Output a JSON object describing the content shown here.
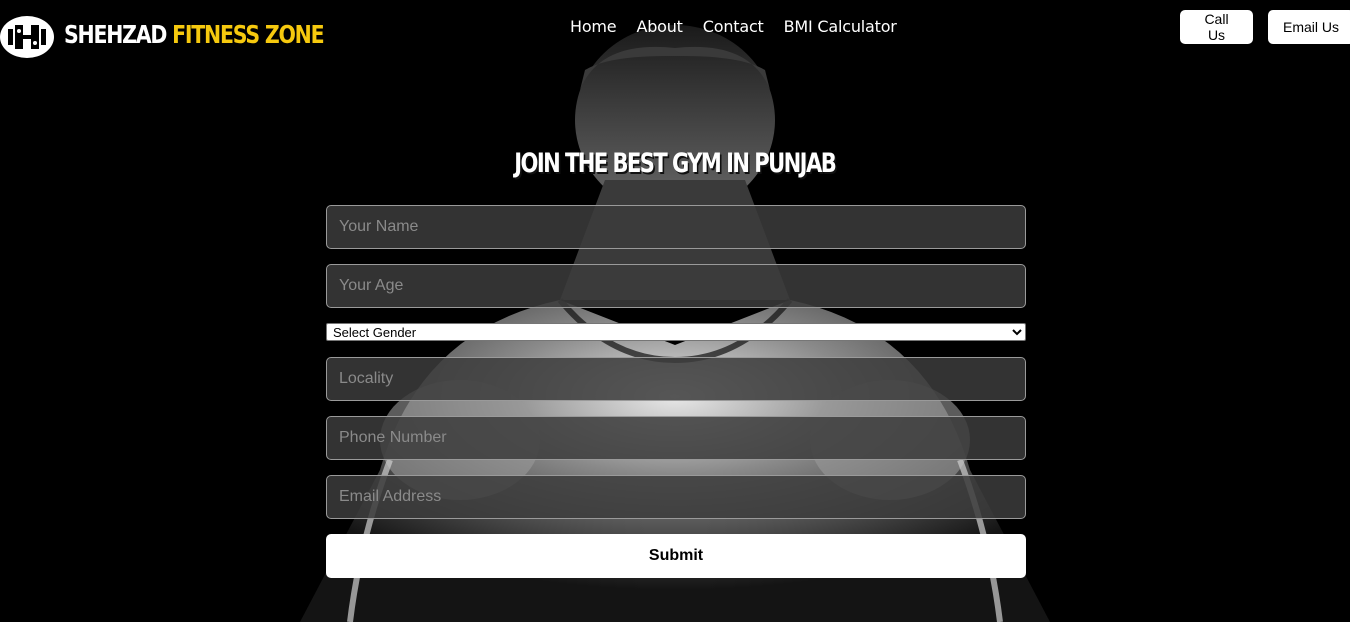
{
  "header": {
    "brand_white": "SHEHZAD",
    "brand_yellow": "FITNESS ZONE",
    "nav": [
      "Home",
      "About",
      "Contact",
      "BMI Calculator"
    ],
    "call_label": "Call Us",
    "email_label": "Email Us"
  },
  "main": {
    "title": "JOIN THE BEST GYM IN PUNJAB"
  },
  "form": {
    "name_placeholder": "Your Name",
    "age_placeholder": "Your Age",
    "gender_selected": "Select Gender",
    "locality_placeholder": "Locality",
    "phone_placeholder": "Phone Number",
    "email_placeholder": "Email Address",
    "submit_label": "Submit"
  },
  "colors": {
    "accent": "#f6c90e",
    "background": "#000000"
  }
}
